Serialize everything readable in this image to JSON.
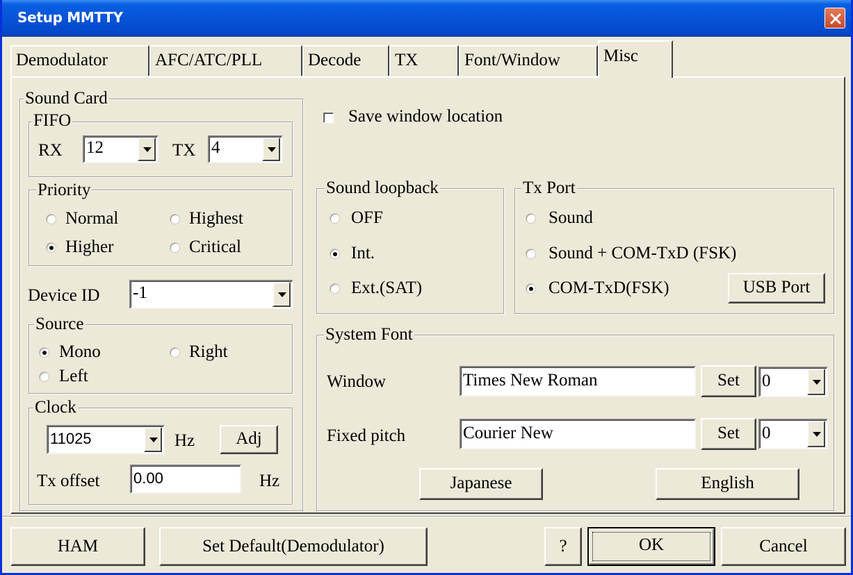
{
  "window": {
    "title": "Setup MMTTY"
  },
  "tabs": [
    "Demodulator",
    "AFC/ATC/PLL",
    "Decode",
    "TX",
    "Font/Window",
    "Misc"
  ],
  "sound_card": {
    "title": "Sound Card",
    "fifo": {
      "title": "FIFO",
      "rx_label": "RX",
      "rx_value": "12",
      "tx_label": "TX",
      "tx_value": "4"
    },
    "priority": {
      "title": "Priority",
      "options": [
        "Normal",
        "Highest",
        "Higher",
        "Critical"
      ],
      "selected": "Higher"
    },
    "device_id": {
      "label": "Device ID",
      "value": "-1"
    },
    "source": {
      "title": "Source",
      "options": [
        "Mono",
        "Right",
        "Left"
      ],
      "selected": "Mono"
    },
    "clock": {
      "title": "Clock",
      "value": "11025",
      "unit": "Hz",
      "adj_label": "Adj",
      "tx_offset_label": "Tx offset",
      "tx_offset_value": "0.00",
      "tx_offset_unit": "Hz"
    }
  },
  "save_window_location": {
    "label": "Save window location",
    "checked": false
  },
  "sound_loopback": {
    "title": "Sound loopback",
    "options": [
      "OFF",
      "Int.",
      "Ext.(SAT)"
    ],
    "selected": "Int."
  },
  "tx_port": {
    "title": "Tx Port",
    "options": [
      "Sound",
      "Sound + COM-TxD (FSK)",
      "COM-TxD(FSK)"
    ],
    "selected": "COM-TxD(FSK)",
    "usb_button": "USB Port"
  },
  "system_font": {
    "title": "System Font",
    "window": {
      "label": "Window",
      "font": "Times New Roman",
      "set_label": "Set",
      "size": "0"
    },
    "fixed": {
      "label": "Fixed pitch",
      "font": "Courier New",
      "set_label": "Set",
      "size": "0"
    },
    "japanese_button": "Japanese",
    "english_button": "English"
  },
  "footer": {
    "ham": "HAM",
    "set_default": "Set Default(Demodulator)",
    "help": "?",
    "ok": "OK",
    "cancel": "Cancel"
  }
}
